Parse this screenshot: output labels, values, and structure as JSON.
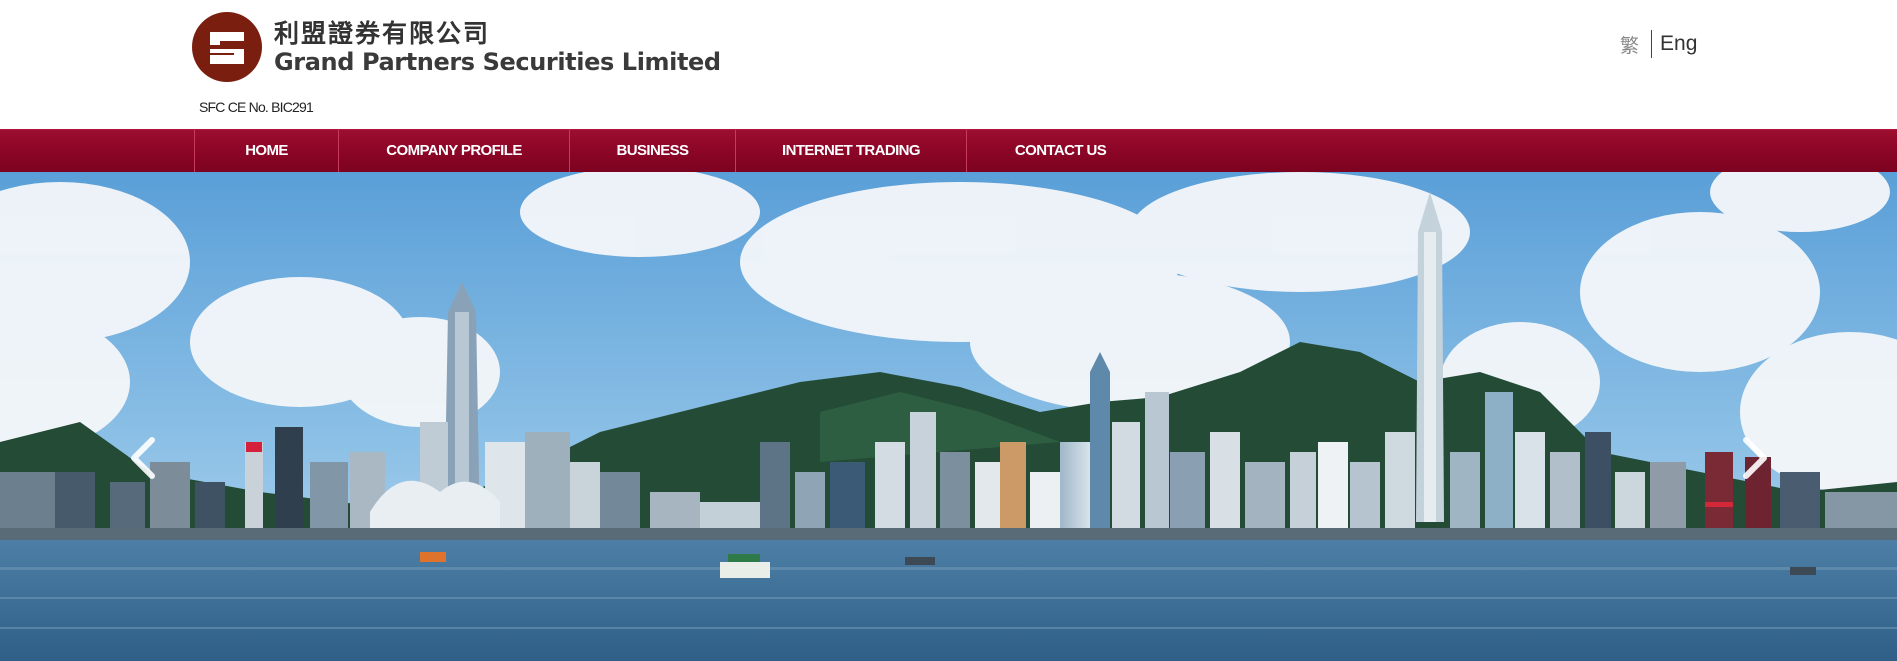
{
  "brand": {
    "name_zh": "利盟證券有限公司",
    "name_en": "Grand Partners Securities Limited",
    "license": "SFC CE No. BIC291",
    "logo_icon": "gs-logo",
    "color": "#7a1f10"
  },
  "language": {
    "traditional_chinese": "繁",
    "english": "Eng"
  },
  "nav": {
    "items": [
      {
        "label": "HOME"
      },
      {
        "label": "COMPANY PROFILE"
      },
      {
        "label": "BUSINESS"
      },
      {
        "label": "INTERNET TRADING"
      },
      {
        "label": "CONTACT US"
      }
    ],
    "background_color": "#8f0628"
  },
  "carousel": {
    "image": "hong-kong-skyline",
    "prev_icon": "chevron-left-icon",
    "next_icon": "chevron-right-icon"
  }
}
